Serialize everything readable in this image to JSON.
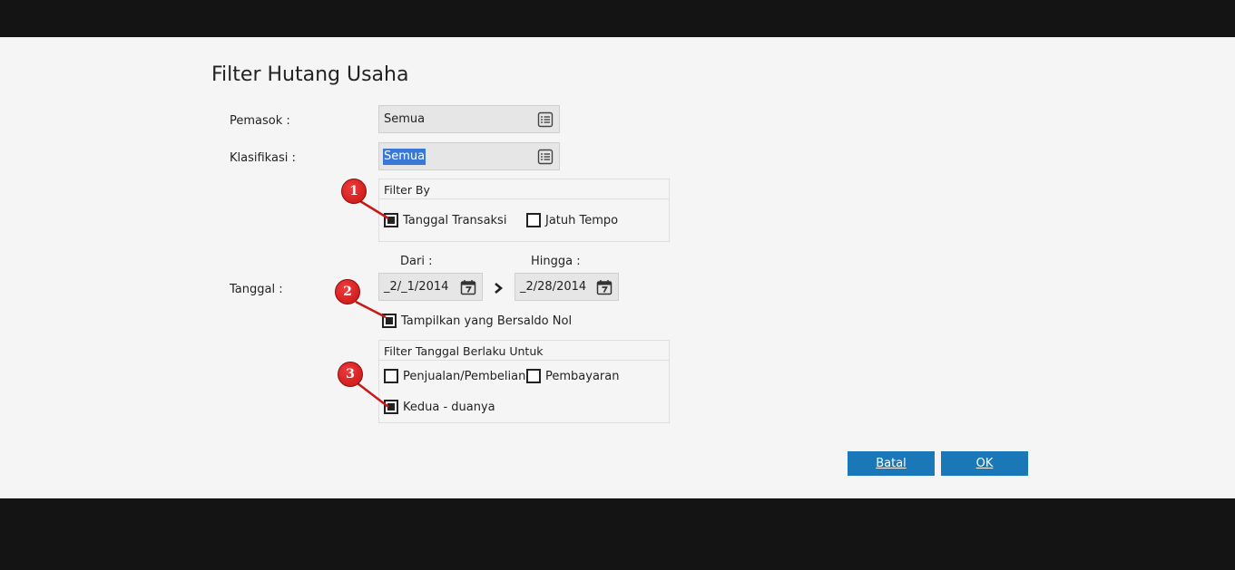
{
  "dialog": {
    "title": "Filter Hutang Usaha"
  },
  "pemasok": {
    "label": "Pemasok :",
    "value": "Semua",
    "icon": "list-icon"
  },
  "klasifikasi": {
    "label": "Klasifikasi :",
    "value": "Semua",
    "icon": "list-icon"
  },
  "filter_by": {
    "title": "Filter By",
    "options": [
      {
        "label": "Tanggal Transaksi",
        "checked": true
      },
      {
        "label": "Jatuh Tempo",
        "checked": false
      }
    ]
  },
  "tanggal": {
    "label": "Tanggal :",
    "dari_label": "Dari :",
    "dari_value": "_2/_1/2014",
    "hingga_label": "Hingga :",
    "hingga_value": "_2/28/2014",
    "separator_icon": "chevron-right-icon",
    "calendar_icon": "calendar-icon"
  },
  "tampilkan_nol": {
    "label": "Tampilkan yang Bersaldo Nol",
    "checked": true
  },
  "filter_tanggal": {
    "title": "Filter Tanggal Berlaku Untuk",
    "options": [
      {
        "label": "Penjualan/Pembelian",
        "checked": false
      },
      {
        "label": "Pembayaran",
        "checked": false
      },
      {
        "label": "Kedua - duanya",
        "checked": true
      }
    ]
  },
  "buttons": {
    "cancel": "Batal",
    "ok": "OK"
  },
  "annotations": [
    "1",
    "2",
    "3"
  ],
  "colors": {
    "button": "#1b78b8",
    "badge": "#d01818",
    "selection": "#3a78d8"
  }
}
